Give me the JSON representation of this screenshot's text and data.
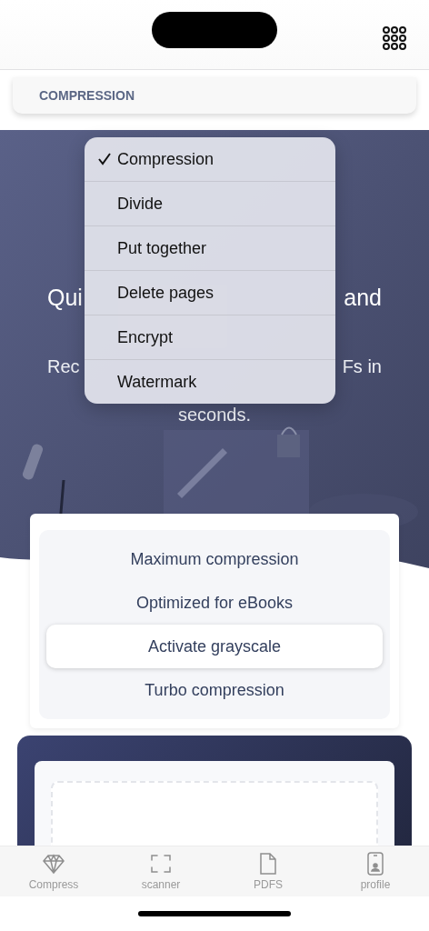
{
  "section": {
    "title": "COMPRESSION"
  },
  "hero": {
    "heading_left": "Qui",
    "heading_right": "and",
    "sub_left": "Rec",
    "sub_right": "Fs in",
    "sub_last": "seconds."
  },
  "menu": [
    {
      "label": "Compression",
      "selected": true
    },
    {
      "label": "Divide",
      "selected": false
    },
    {
      "label": "Put together",
      "selected": false
    },
    {
      "label": "Delete pages",
      "selected": false
    },
    {
      "label": "Encrypt",
      "selected": false
    },
    {
      "label": "Watermark",
      "selected": false
    }
  ],
  "options": [
    {
      "label": "Maximum compression",
      "selected": false
    },
    {
      "label": "Optimized for eBooks",
      "selected": false
    },
    {
      "label": "Activate grayscale",
      "selected": true
    },
    {
      "label": "Turbo compression",
      "selected": false
    }
  ],
  "tabs": [
    {
      "label": "Compress"
    },
    {
      "label": "scanner"
    },
    {
      "label": "PDFS"
    },
    {
      "label": "profile"
    }
  ]
}
